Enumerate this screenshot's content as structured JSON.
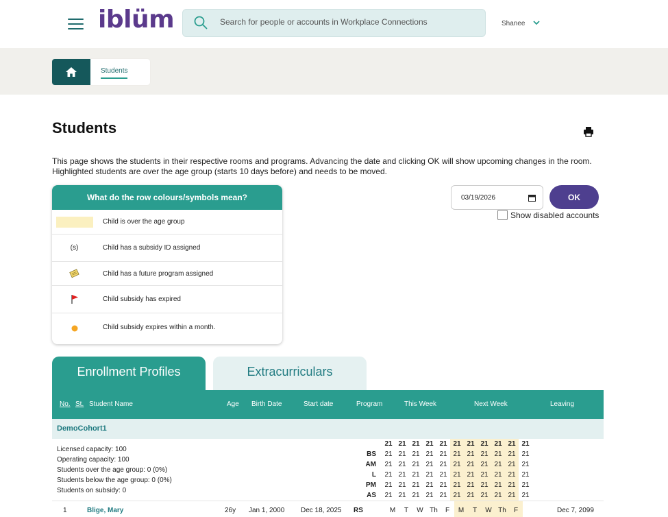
{
  "header": {
    "logo": "iblüm",
    "search_placeholder": "Search for people or accounts in Workplace Connections",
    "user_name": "Shanee"
  },
  "breadcrumb": {
    "current": "Students"
  },
  "page": {
    "title": "Students",
    "description": "This page shows the students in their respective rooms and programs. Advancing the date and clicking OK will show upcoming changes in the room. Highlighted students are over the age group (starts 10 days before) and needs to be moved."
  },
  "legend": {
    "title": "What do the row colours/symbols mean?",
    "items": [
      {
        "symbol": "",
        "text": "Child is over the age group",
        "color": "#fbf0c0"
      },
      {
        "symbol": "(s)",
        "text": "Child has a subsidy ID assigned"
      },
      {
        "symbol": "note-icon",
        "text": "Child has a future program assigned"
      },
      {
        "symbol": "red-flag-icon",
        "text": "Child subsidy has expired",
        "color": "#e02020"
      },
      {
        "symbol": "orange-dot-icon",
        "text": "Child subsidy expires within a month.",
        "color": "#f5a623"
      }
    ]
  },
  "controls": {
    "date_value": "03/19/2026",
    "ok_label": "OK",
    "show_disabled_label": "Show disabled accounts"
  },
  "tabs": [
    {
      "label": "Enrollment Profiles",
      "active": true
    },
    {
      "label": "Extracurriculars",
      "active": false
    }
  ],
  "table": {
    "headers": {
      "no": "No.",
      "st": "St.",
      "name": "Student Name",
      "age": "Age",
      "birth": "Birth Date",
      "start": "Start date",
      "program": "Program",
      "this_week": "This Week",
      "next_week": "Next Week",
      "leaving": "Leaving"
    },
    "cohort": {
      "name": "DemoCohort1",
      "stats": [
        "Licensed capacity: 100",
        "Operating capacity: 100",
        "Students over the age group: 0 (0%)",
        "Students below the age group: 0 (0%)",
        "Students on subsidy: 0"
      ],
      "program_codes": [
        "BS",
        "AM",
        "L",
        "PM",
        "AS"
      ],
      "header_value": "21",
      "cell_value": "21"
    },
    "students": [
      {
        "no": "1",
        "name": "Blige, Mary",
        "age": "26y",
        "birth": "Jan 1, 2000",
        "start": "Dec 18, 2025",
        "program": "RS",
        "days": [
          "M",
          "T",
          "W",
          "Th",
          "F",
          "M",
          "T",
          "W",
          "Th",
          "F"
        ],
        "leaving": "Dec 7, 2099"
      }
    ]
  },
  "colors": {
    "teal": "#2a9d8f",
    "dark_teal": "#15585b",
    "purple": "#4e3f8f",
    "highlight": "#fbf0cf"
  }
}
